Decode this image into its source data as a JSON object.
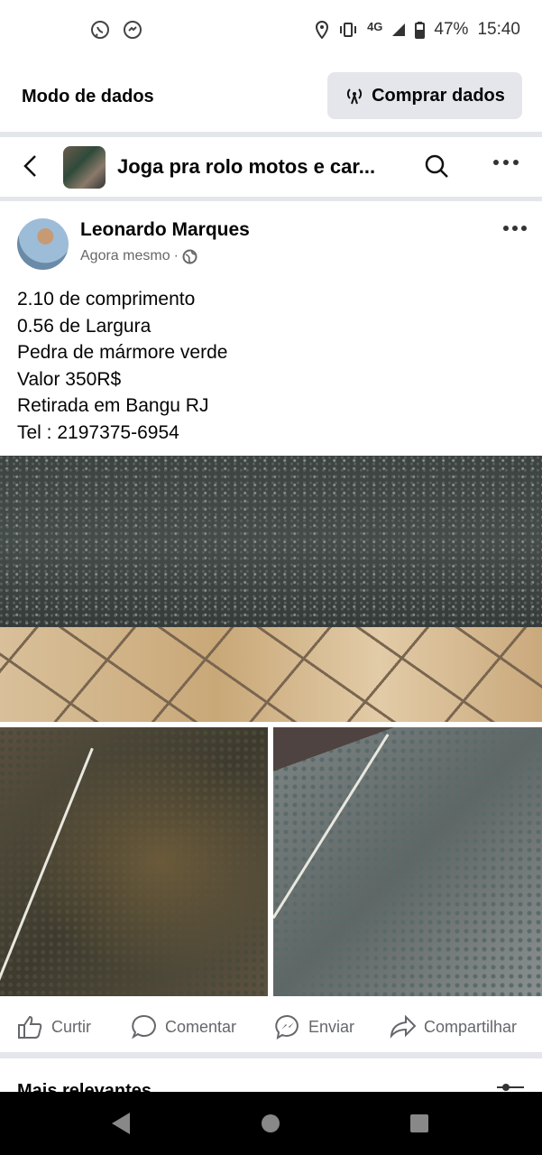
{
  "status_bar": {
    "network": "4G",
    "battery": "47%",
    "time": "15:40"
  },
  "data_mode": {
    "label": "Modo de dados",
    "buy_button": "Comprar dados"
  },
  "group_header": {
    "title": "Joga pra rolo  motos e car..."
  },
  "post": {
    "author": "Leonardo Marques",
    "time": "Agora mesmo",
    "separator": "·",
    "lines": [
      "2.10 de comprimento",
      "0.56 de Largura",
      "Pedra de mármore verde",
      "Valor 350R$",
      "Retirada em Bangu RJ",
      "Tel : 2197375-6954"
    ]
  },
  "actions": {
    "like": "Curtir",
    "comment": "Comentar",
    "send": "Enviar",
    "share": "Compartilhar"
  },
  "comments": {
    "sort_label": "Mais relevantes"
  },
  "colors": {
    "divider": "#e4e6eb",
    "secondary_text": "#65676b",
    "nav_bar": "#000000"
  }
}
